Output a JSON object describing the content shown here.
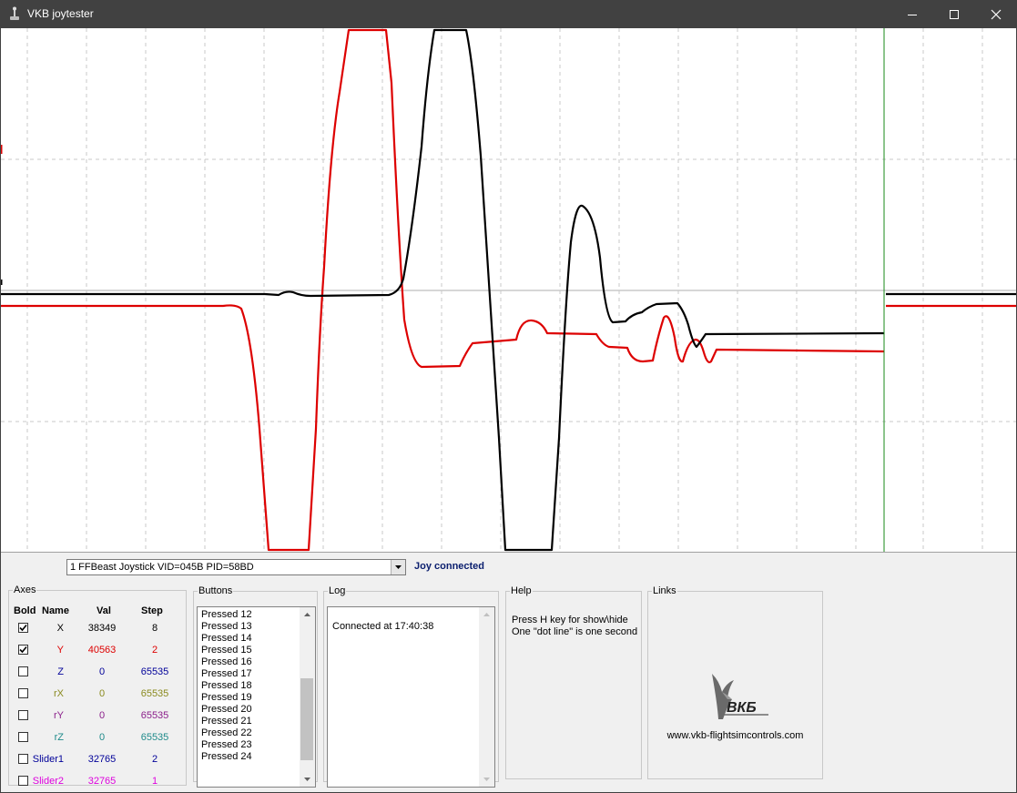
{
  "window": {
    "title": "VKB joytester",
    "controls": [
      "minimize",
      "maximize",
      "close"
    ]
  },
  "plot": {
    "background": "#ffffff",
    "series_colors": {
      "x": "#000000",
      "y": "#dd0000"
    },
    "cursor_color": "#1a8a1a",
    "time_grid": "one dot line is one second"
  },
  "device": {
    "selected": "1 FFBeast Joystick VID=045B PID=58BD",
    "status": "Joy connected",
    "status_color": "#0a1e6e"
  },
  "axes": {
    "title": "Axes",
    "headers": {
      "bold": "Bold",
      "name": "Name",
      "val": "Val",
      "step": "Step"
    },
    "rows": [
      {
        "name": "X",
        "val": "38349",
        "step": "8",
        "checked": true,
        "color": "#000000"
      },
      {
        "name": "Y",
        "val": "40563",
        "step": "2",
        "checked": true,
        "color": "#dd0000"
      },
      {
        "name": "Z",
        "val": "0",
        "step": "65535",
        "checked": false,
        "color": "#000099"
      },
      {
        "name": "rX",
        "val": "0",
        "step": "65535",
        "checked": false,
        "color": "#8a8a1e"
      },
      {
        "name": "rY",
        "val": "0",
        "step": "65535",
        "checked": false,
        "color": "#8a1e8a"
      },
      {
        "name": "rZ",
        "val": "0",
        "step": "65535",
        "checked": false,
        "color": "#1e8a8a"
      },
      {
        "name": "Slider1",
        "val": "32765",
        "step": "2",
        "checked": false,
        "color": "#000099"
      },
      {
        "name": "Slider2",
        "val": "32765",
        "step": "1",
        "checked": false,
        "color": "#dd00dd"
      }
    ]
  },
  "buttons": {
    "title": "Buttons",
    "items": [
      "Pressed 12",
      "Pressed 13",
      "Pressed 14",
      "Pressed 15",
      "Pressed 16",
      "Pressed 17",
      "Pressed 18",
      "Pressed 19",
      "Pressed 20",
      "Pressed 21",
      "Pressed 22",
      "Pressed 23",
      "Pressed 24"
    ],
    "scroll_position": 0.8
  },
  "log": {
    "title": "Log",
    "lines": [
      "Connected at 17:40:38"
    ]
  },
  "help": {
    "title": "Help",
    "lines": [
      "Press H key for show\\hide",
      "One \"dot line\" is one second"
    ]
  },
  "links": {
    "title": "Links",
    "logo_text": "ВКБ",
    "url": "www.vkb-flightsimcontrols.com"
  }
}
